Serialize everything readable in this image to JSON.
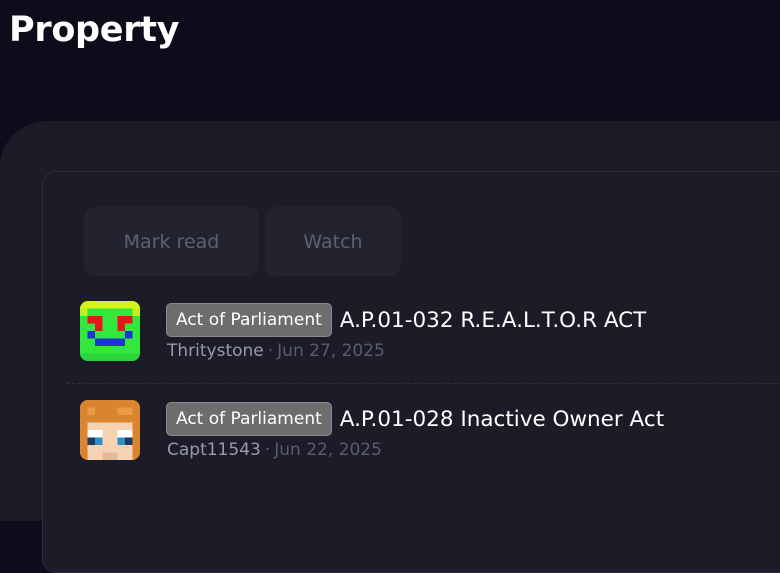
{
  "page": {
    "title": "Property"
  },
  "actions": {
    "mark_read": "Mark read",
    "watch": "Watch"
  },
  "threads": [
    {
      "prefix": "Act of Parliament",
      "title": "A.P.01-032 R.E.A.L.T.O.R ACT",
      "author": "Thritystone",
      "separator": "·",
      "date": "Jun 27, 2025",
      "avatar_icon": "minecraft-skin-green-face-icon"
    },
    {
      "prefix": "Act of Parliament",
      "title": "A.P.01-028 Inactive Owner Act",
      "author": "Capt11543",
      "separator": "·",
      "date": "Jun 22, 2025",
      "avatar_icon": "minecraft-skin-orange-hair-icon"
    }
  ],
  "colors": {
    "background": "#0c0c1a",
    "panel": "#1c1c28",
    "button": "#232330",
    "prefix_badge": "#6d6d6d"
  }
}
